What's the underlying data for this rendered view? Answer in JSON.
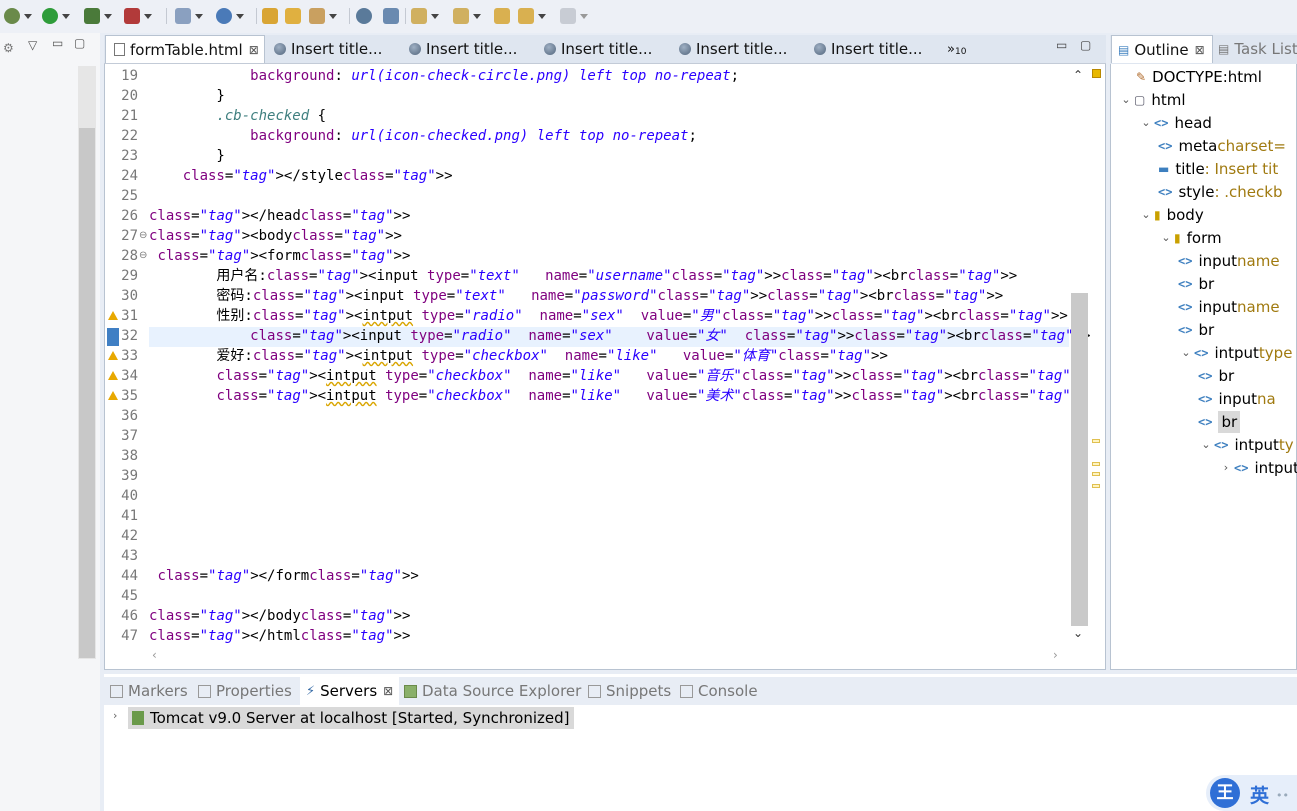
{
  "editor": {
    "tabs": [
      {
        "label": "formTable.html",
        "close": "⊠",
        "active": true
      },
      {
        "label": "Insert title...",
        "active": false
      },
      {
        "label": "Insert title...",
        "active": false
      },
      {
        "label": "Insert title...",
        "active": false
      },
      {
        "label": "Insert title...",
        "active": false
      },
      {
        "label": "Insert title...",
        "active": false
      }
    ],
    "overflow_label": "»",
    "overflow_count": "10",
    "lines": [
      {
        "n": "19",
        "text": "            background: url(icon-check-circle.png) left top no-repeat;"
      },
      {
        "n": "20",
        "text": "        }"
      },
      {
        "n": "21",
        "text": "        .cb-checked {"
      },
      {
        "n": "22",
        "text": "            background: url(icon-checked.png) left top no-repeat;"
      },
      {
        "n": "23",
        "text": "        }"
      },
      {
        "n": "24",
        "text": "    </style>"
      },
      {
        "n": "25",
        "text": ""
      },
      {
        "n": "26",
        "text": "</head>"
      },
      {
        "n": "27",
        "text": "<body>",
        "fold": true
      },
      {
        "n": "28",
        "text": " <form>",
        "fold": true
      },
      {
        "n": "29",
        "text": "        用户名:<input type=\"text\"   name=\"username\"><br>"
      },
      {
        "n": "30",
        "text": "        密码:<input type=\"text\"   name=\"password\"><br>"
      },
      {
        "n": "31",
        "text": "        性别:<intput type=\"radio\"  name=\"sex\"  value=\"男\"><br>",
        "warn": true
      },
      {
        "n": "32",
        "text": "            <input type=\"radio\"  name=\"sex\"    value=\"女\"  ><br>",
        "current": true
      },
      {
        "n": "33",
        "text": "        爱好:<intput type=\"checkbox\"  name=\"like\"   value=\"体育\">",
        "warn": true
      },
      {
        "n": "34",
        "text": "        <intput type=\"checkbox\"  name=\"like\"   value=\"音乐\"><br>",
        "warn": true
      },
      {
        "n": "35",
        "text": "        <intput type=\"checkbox\"  name=\"like\"   value=\"美术\"><br>",
        "warn": true
      },
      {
        "n": "36",
        "text": ""
      },
      {
        "n": "37",
        "text": ""
      },
      {
        "n": "38",
        "text": ""
      },
      {
        "n": "39",
        "text": ""
      },
      {
        "n": "40",
        "text": ""
      },
      {
        "n": "41",
        "text": ""
      },
      {
        "n": "42",
        "text": ""
      },
      {
        "n": "43",
        "text": ""
      },
      {
        "n": "44",
        "text": " </form>"
      },
      {
        "n": "45",
        "text": ""
      },
      {
        "n": "46",
        "text": "</body>"
      },
      {
        "n": "47",
        "text": "</html>"
      }
    ]
  },
  "outline": {
    "tabs": [
      {
        "label": "Outline",
        "active": true
      },
      {
        "label": "Task List",
        "active": false
      }
    ],
    "nodes": [
      {
        "label": "DOCTYPE:html",
        "detail": ""
      },
      {
        "label": "html",
        "detail": ""
      },
      {
        "label": "head",
        "detail": ""
      },
      {
        "label": "meta",
        "detail": "charset="
      },
      {
        "label": "title",
        "detail": " : Insert tit"
      },
      {
        "label": "style",
        "detail": " : .checkb"
      },
      {
        "label": "body",
        "detail": ""
      },
      {
        "label": "form",
        "detail": ""
      },
      {
        "label": "input",
        "detail": "name"
      },
      {
        "label": "br",
        "detail": ""
      },
      {
        "label": "input",
        "detail": "name"
      },
      {
        "label": "br",
        "detail": ""
      },
      {
        "label": "intput",
        "detail": "type"
      },
      {
        "label": "br",
        "detail": ""
      },
      {
        "label": "input",
        "detail": "na"
      },
      {
        "label": "br",
        "detail": ""
      },
      {
        "label": "intput",
        "detail": "ty"
      },
      {
        "label": "intput",
        "detail": ""
      }
    ]
  },
  "bottom": {
    "tabs": [
      {
        "label": "Markers",
        "active": false
      },
      {
        "label": "Properties",
        "active": false
      },
      {
        "label": "Servers",
        "active": true
      },
      {
        "label": "Data Source Explorer",
        "active": false
      },
      {
        "label": "Snippets",
        "active": false
      },
      {
        "label": "Console",
        "active": false
      }
    ],
    "server": "Tomcat v9.0 Server at localhost  [Started, Synchronized]"
  },
  "ime": {
    "label": "英",
    "logo": "王"
  },
  "colors": {
    "tag": "#3f7f7f",
    "attr": "#7f007f",
    "value": "#2a00ff",
    "warn": "#e8a800",
    "accent": "#3d7fbf"
  }
}
